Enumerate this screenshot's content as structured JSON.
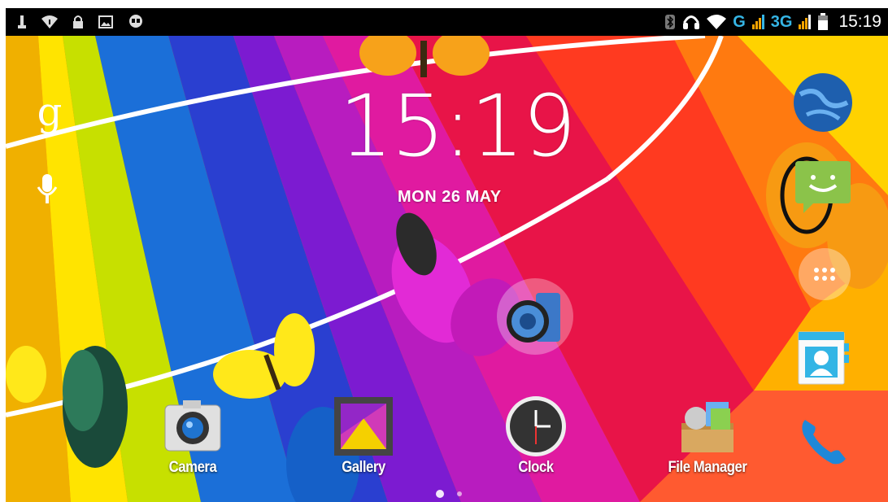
{
  "status_bar": {
    "left_icons": [
      "usb-debug-icon",
      "wifi-alert-icon",
      "lock-icon",
      "image-icon",
      "hangouts-icon"
    ],
    "right_icons": [
      "bluetooth-icon",
      "headset-icon",
      "wifi-icon"
    ],
    "network_g": "G",
    "network_3g": "3G",
    "time": "15:19",
    "accent_color": "#35b5e5",
    "signal_color": "#f7a400"
  },
  "lockclock": {
    "time": "15:19",
    "date": "MON 26 MAY"
  },
  "search": {
    "google_glyph": "g"
  },
  "dock": {
    "items": [
      {
        "label": "Camera"
      },
      {
        "label": "Gallery"
      },
      {
        "label": "Clock"
      },
      {
        "label": "File Manager"
      },
      {
        "label": ""
      }
    ]
  },
  "right_column": {
    "icons": [
      "browser-globe-icon",
      "messaging-icon",
      "all-apps-icon",
      "contacts-icon",
      "phone-icon"
    ]
  },
  "desktop_icons": [
    "music-speaker-icon"
  ],
  "page_indicator": {
    "pages": 2,
    "current": 1
  }
}
